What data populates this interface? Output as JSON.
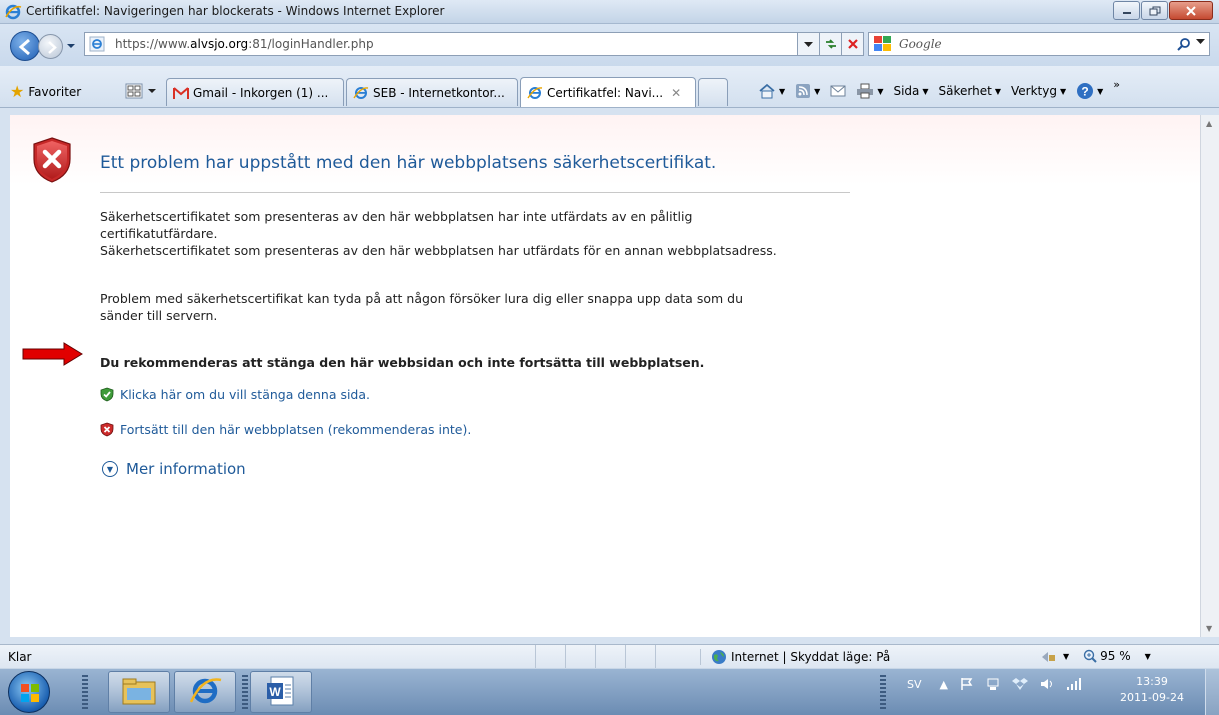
{
  "window": {
    "title": "Certifikatfel: Navigeringen har blockerats - Windows Internet Explorer"
  },
  "address": {
    "url_prefix": "https://www.",
    "url_domain": "alvsjo.org",
    "url_suffix": ":81/loginHandler.php",
    "search_placeholder": "Google"
  },
  "toolbar": {
    "favorites_label": "Favoriter",
    "tabs": [
      {
        "label": "Gmail - Inkorgen (1) ..."
      },
      {
        "label": "SEB - Internetkontor..."
      },
      {
        "label": "Certifikatfel: Navi..."
      }
    ],
    "commands": {
      "page": "Sida",
      "security": "Säkerhet",
      "tools": "Verktyg"
    }
  },
  "content": {
    "heading": "Ett problem har uppstått med den här webbplatsens säkerhetscertifikat.",
    "para1_line1": "Säkerhetscertifikatet som presenteras av den här webbplatsen har inte utfärdats av en pålitlig",
    "para1_line2": "certifikatutfärdare.",
    "para1_line3": "Säkerhetscertifikatet som presenteras av den här webbplatsen har utfärdats för en annan webbplatsadress.",
    "para2_line1": "Problem med säkerhetscertifikat kan tyda på att någon försöker lura dig eller snappa upp data som du",
    "para2_line2": "sänder till servern.",
    "recommendation": "Du rekommenderas att stänga den här webbsidan och inte fortsätta till webbplatsen.",
    "close_link": "Klicka här om du vill stänga denna sida.",
    "continue_link": "Fortsätt till den här webbplatsen (rekommenderas inte).",
    "more_info": "Mer information"
  },
  "status": {
    "text": "Klar",
    "zone": "Internet | Skyddat läge: På",
    "zoom": "95 %"
  },
  "taskbar": {
    "language": "SV",
    "time": "13:39",
    "date": "2011-09-24"
  },
  "colors": {
    "link": "#1f5a99",
    "arrow": "#e10000"
  }
}
